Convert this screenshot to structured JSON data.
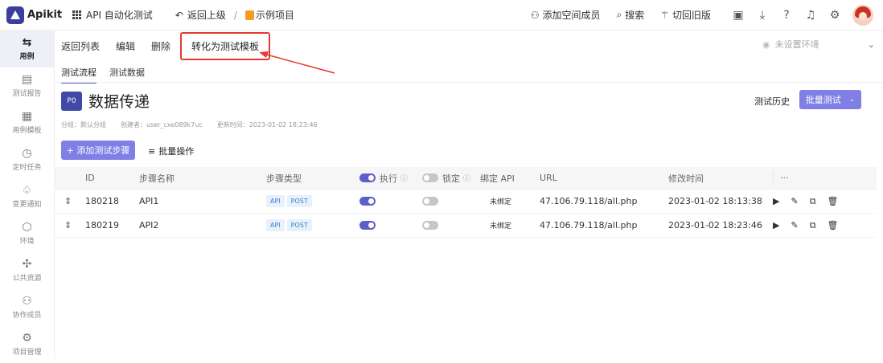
{
  "topbar": {
    "app_name": "Apikit",
    "project_switch": "API 自动化测试",
    "back_up": "返回上级",
    "separator": "/",
    "demo_project": "示例项目",
    "add_member": "添加空间成员",
    "search": "搜索",
    "old_version": "切回旧版"
  },
  "sidebar": {
    "items": [
      {
        "label": "用例",
        "icon": "test-case-icon"
      },
      {
        "label": "测试报告",
        "icon": "report-icon"
      },
      {
        "label": "用例模板",
        "icon": "template-icon"
      },
      {
        "label": "定时任务",
        "icon": "timer-icon"
      },
      {
        "label": "变更通知",
        "icon": "bell-icon"
      },
      {
        "label": "环境",
        "icon": "cube-icon"
      },
      {
        "label": "公共资源",
        "icon": "puzzle-icon"
      },
      {
        "label": "协作成员",
        "icon": "users-icon"
      },
      {
        "label": "项目管理",
        "icon": "gear-icon"
      }
    ]
  },
  "actions": {
    "back_list": "返回列表",
    "edit": "编辑",
    "delete": "删除",
    "convert_template": "转化为测试模板"
  },
  "env": {
    "placeholder": "未设置环境"
  },
  "tabs": [
    "测试流程",
    "测试数据"
  ],
  "case": {
    "priority": "P0",
    "title": "数据传递",
    "history": "测试历史",
    "batch_test": "批量测试",
    "group": "分组：默认分组",
    "creator": "创建者：user_cxe089k7uc",
    "updated": "更新时间：2023-01-02 18:23:46"
  },
  "toolbar": {
    "add_step": "+ 添加测试步骤",
    "batch_op": "批量操作"
  },
  "table": {
    "headers": {
      "id": "ID",
      "name": "步骤名称",
      "type": "步骤类型",
      "exec": "执行",
      "lock": "锁定",
      "bind": "绑定 API",
      "url": "URL",
      "time": "修改时间",
      "more": "···"
    },
    "rows": [
      {
        "id": "180218",
        "name": "API1",
        "tags": [
          "API",
          "POST"
        ],
        "exec": true,
        "lock": false,
        "bind": "未绑定",
        "url": "47.106.79.118/all.php",
        "time": "2023-01-02 18:13:38"
      },
      {
        "id": "180219",
        "name": "API2",
        "tags": [
          "API",
          "POST"
        ],
        "exec": true,
        "lock": false,
        "bind": "未绑定",
        "url": "47.106.79.118/all.php",
        "time": "2023-01-02 18:23:46"
      }
    ]
  },
  "colors": {
    "accent": "#7f7fe6",
    "primary_dark": "#3f4aa8",
    "highlight": "#e53a2f"
  }
}
